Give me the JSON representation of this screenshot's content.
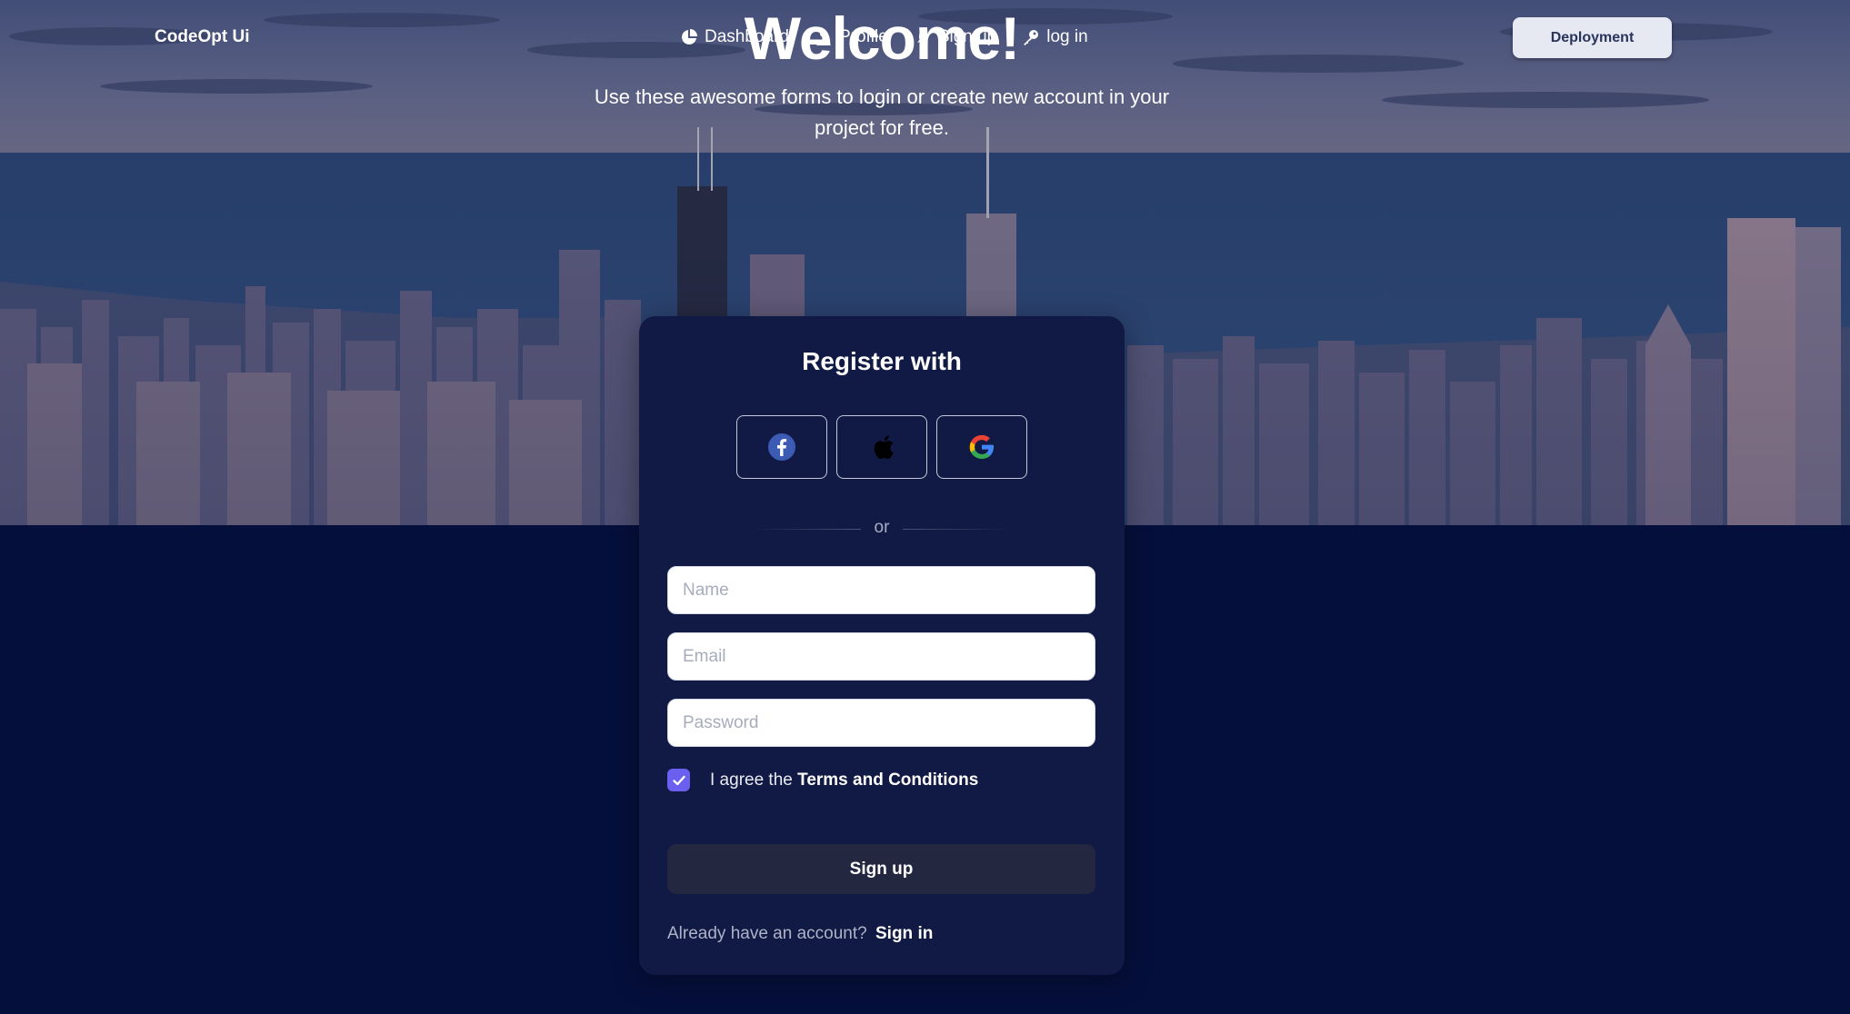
{
  "navbar": {
    "brand": "CodeOpt Ui",
    "links": [
      {
        "label": "Dashboard",
        "icon": "pie-chart-icon"
      },
      {
        "label": "Profile",
        "icon": "user-icon"
      },
      {
        "label": "Sign up",
        "icon": "rocket-icon"
      },
      {
        "label": "log in",
        "icon": "key-icon"
      }
    ],
    "deploy_label": "Deployment"
  },
  "hero": {
    "title": "Welcome!",
    "subtitle": "Use these awesome forms to login or create new account in your project for free."
  },
  "register": {
    "title": "Register with",
    "social": [
      {
        "name": "facebook",
        "icon": "facebook-icon"
      },
      {
        "name": "apple",
        "icon": "apple-icon"
      },
      {
        "name": "google",
        "icon": "google-icon"
      }
    ],
    "divider_text": "or",
    "name_placeholder": "Name",
    "email_placeholder": "Email",
    "password_placeholder": "Password",
    "agree_prefix": "I agree the",
    "agree_link": "Terms and Conditions",
    "agree_checked": true,
    "signup_label": "Sign up",
    "have_account_text": "Already have an account?",
    "signin_link": "Sign in"
  },
  "colors": {
    "background": "#050f3b",
    "card": "#111a44",
    "checkbox": "#6b5ff0",
    "signup_button": "#232840"
  }
}
